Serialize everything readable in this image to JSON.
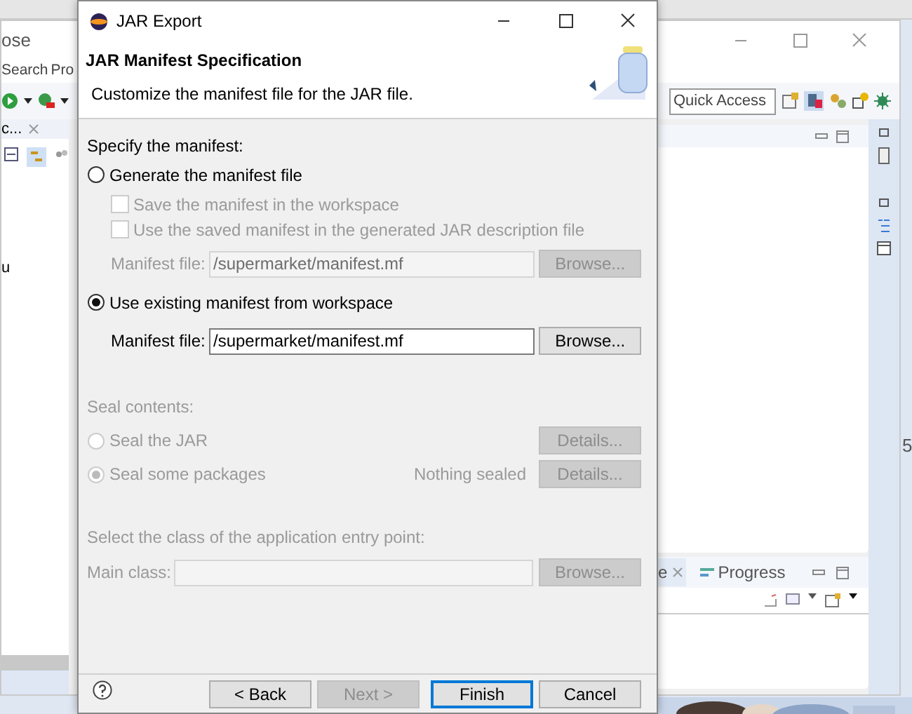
{
  "workbench": {
    "title": "ose",
    "menu": [
      "Search",
      "Pro"
    ],
    "quick_access": {
      "placeholder": "Quick Access"
    },
    "left_view": {
      "tab": "c...",
      "tree_item": "u"
    },
    "bottom_view": {
      "tabs": [
        {
          "label": "e",
          "selected": true
        },
        {
          "label": "Progress",
          "selected": false
        }
      ]
    },
    "side_text": "5"
  },
  "dialog": {
    "title": "JAR Export",
    "heading": "JAR Manifest Specification",
    "description": "Customize the manifest file for the JAR file.",
    "specify_label": "Specify the manifest:",
    "generate": {
      "label": "Generate the manifest file",
      "selected": false,
      "options": [
        {
          "label": "Save the manifest in the workspace",
          "checked": false,
          "disabled": true
        },
        {
          "label": "Use the saved manifest in the generated JAR description file",
          "checked": false,
          "disabled": true
        }
      ],
      "field": {
        "label": "Manifest file:",
        "value": "/supermarket/manifest.mf",
        "button": "Browse...",
        "disabled": true
      }
    },
    "existing": {
      "label": "Use existing manifest from workspace",
      "selected": true,
      "field": {
        "label": "Manifest file:",
        "value": "/supermarket/manifest.mf",
        "button": "Browse...",
        "disabled": false
      }
    },
    "seal": {
      "label": "Seal contents:",
      "disabled": true,
      "options": [
        {
          "label": "Seal the JAR",
          "selected": false,
          "button": "Details..."
        },
        {
          "label": "Seal some packages",
          "selected": true,
          "status": "Nothing sealed",
          "button": "Details..."
        }
      ]
    },
    "entry_point": {
      "label": "Select the class of the application entry point:",
      "field_label": "Main class:",
      "button": "Browse...",
      "disabled": true
    },
    "buttons": [
      {
        "label": "< Back",
        "disabled": false,
        "default": false
      },
      {
        "label": "Next >",
        "disabled": true,
        "default": false
      },
      {
        "label": "Finish",
        "disabled": false,
        "default": true
      },
      {
        "label": "Cancel",
        "disabled": false,
        "default": false
      }
    ]
  }
}
